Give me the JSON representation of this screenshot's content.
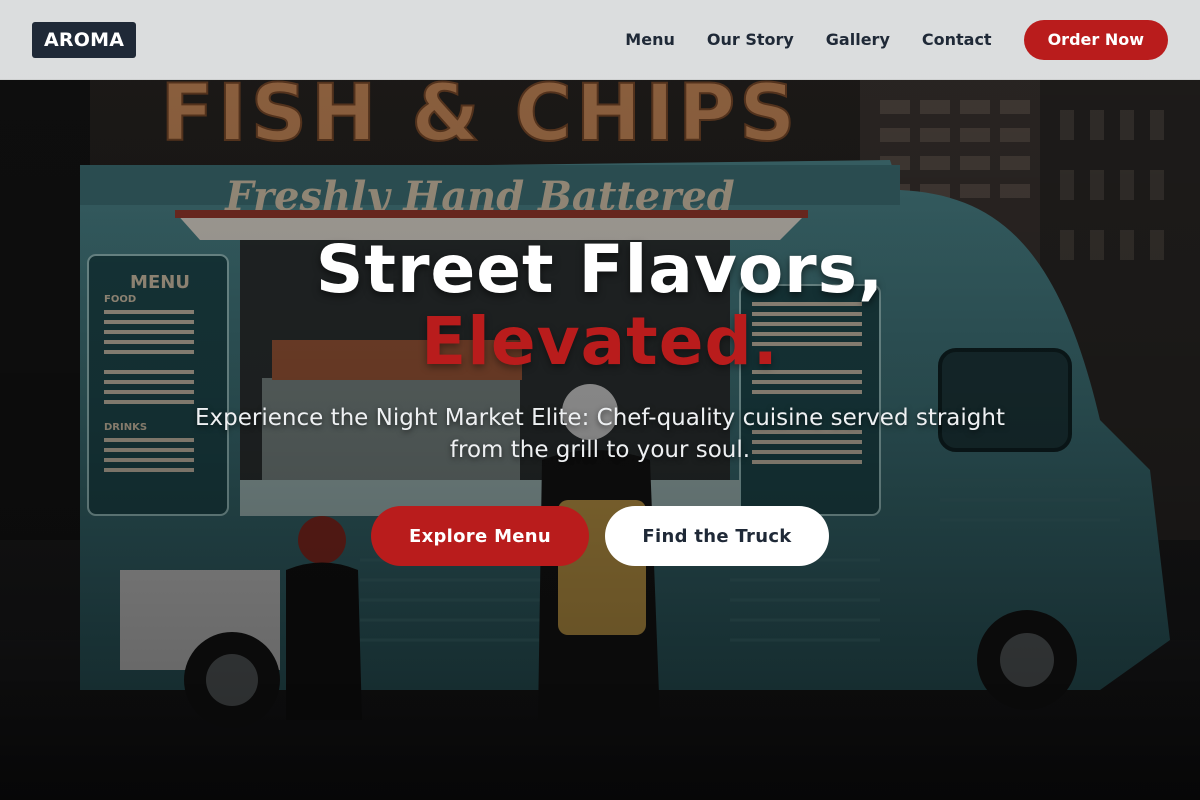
{
  "colors": {
    "accent": "#b91c1c",
    "dark": "#1f2937",
    "nav_bg": "#eceef0",
    "white": "#ffffff"
  },
  "nav": {
    "logo": "AROMA",
    "links": [
      "Menu",
      "Our Story",
      "Gallery",
      "Contact"
    ],
    "order_label": "Order Now"
  },
  "hero": {
    "headline_1": "Street Flavors,",
    "headline_2": "Elevated.",
    "subtitle": "Experience the Night Market Elite: Chef-quality cuisine served straight from the grill to your soul.",
    "primary_cta": "Explore Menu",
    "secondary_cta": "Find the Truck",
    "image": {
      "sign_text": "FISH & CHIPS",
      "truck_banner": "Freshly Hand Battered",
      "board_title": "MENU",
      "board_sections": [
        "FOOD",
        "DRINKS"
      ]
    }
  }
}
